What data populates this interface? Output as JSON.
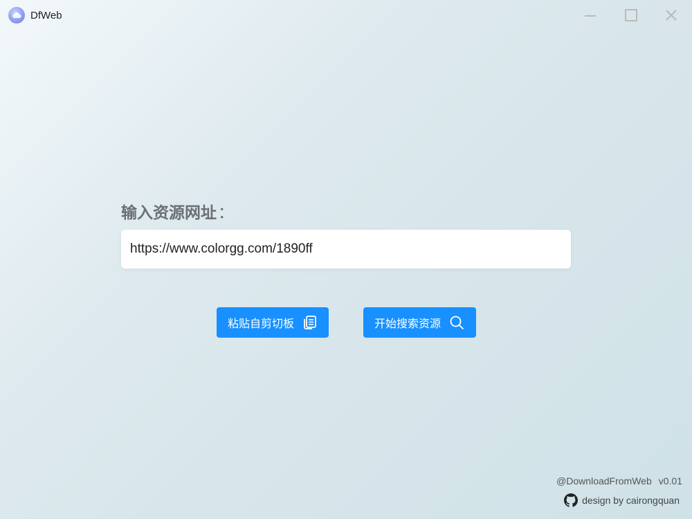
{
  "window": {
    "title": "DfWeb",
    "logo_icon": "cloud-download-icon",
    "controls": [
      "minimize-icon",
      "maximize-icon",
      "close-icon"
    ]
  },
  "form": {
    "label": "输入资源网址",
    "label_colon": "：",
    "url_value": "https://www.colorgg.com/1890ff"
  },
  "buttons": {
    "paste_label": "粘贴自剪切板",
    "paste_icon": "clipboard-icon",
    "search_label": "开始搜索资源",
    "search_icon": "search-icon"
  },
  "footer": {
    "brand": "@DownloadFromWeb",
    "version": "v0.01",
    "design_text": "design by cairongquan",
    "design_icon": "github-icon"
  },
  "colors": {
    "accent": "#1890ff"
  }
}
